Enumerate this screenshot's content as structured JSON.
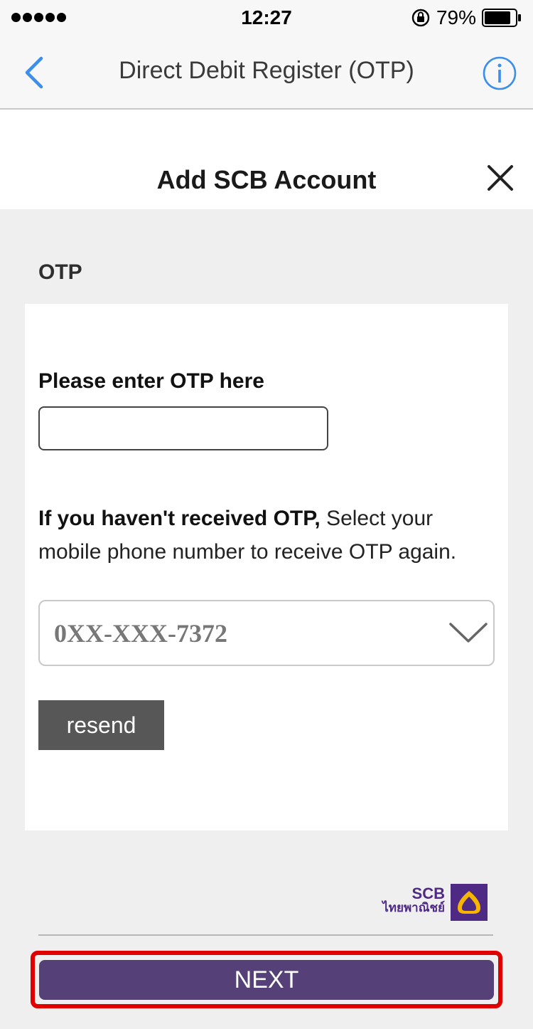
{
  "status_bar": {
    "time": "12:27",
    "battery": "79%"
  },
  "nav": {
    "title": "Direct Debit Register (OTP)"
  },
  "sheet": {
    "title": "Add SCB Account"
  },
  "section": {
    "label": "OTP"
  },
  "form": {
    "otp_label": "Please enter OTP here",
    "otp_value": "",
    "resend_bold": "If you haven't received OTP,",
    "resend_rest": " Select your mobile phone number to receive OTP again.",
    "phone_selected": "0XX-XXX-7372",
    "resend_button": "resend"
  },
  "logo": {
    "name": "SCB",
    "thai": "ไทยพาณิชย์"
  },
  "footer": {
    "next_button": "NEXT"
  },
  "colors": {
    "brand_purple": "#554078",
    "highlight_red": "#e00000",
    "ios_blue": "#3b8eea"
  },
  "icons": [
    "signal-icon",
    "lock-rotation-icon",
    "battery-icon",
    "back-chevron-icon",
    "info-icon",
    "close-icon",
    "chevron-down-icon",
    "scb-logo-icon"
  ]
}
